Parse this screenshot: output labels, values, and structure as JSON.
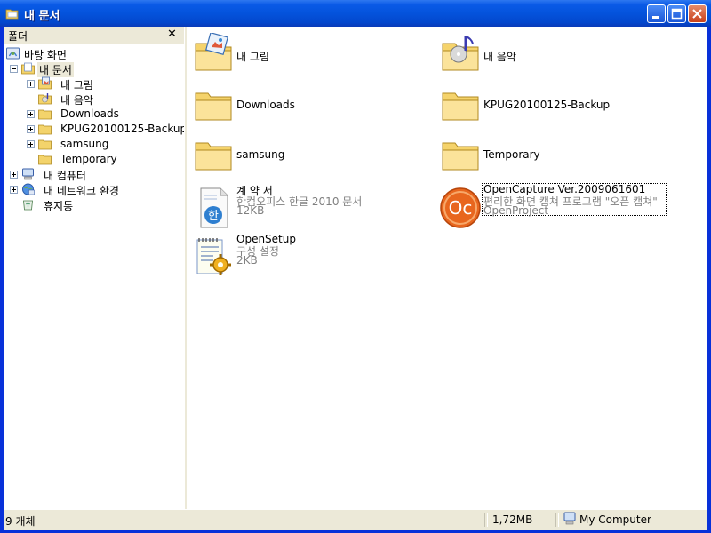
{
  "window": {
    "title": "내 문서"
  },
  "folder_pane": {
    "header": "폴더",
    "tree": [
      {
        "label": "바탕 화면",
        "icon": "desktop-icon",
        "level": 0,
        "expander": "none"
      },
      {
        "label": "내 문서",
        "icon": "my-documents-icon",
        "level": 1,
        "expander": "minus",
        "selected": true
      },
      {
        "label": "내 그림",
        "icon": "my-pictures-icon",
        "level": 2,
        "expander": "plus"
      },
      {
        "label": "내 음악",
        "icon": "my-music-icon",
        "level": 2,
        "expander": "none"
      },
      {
        "label": "Downloads",
        "icon": "folder-icon",
        "level": 2,
        "expander": "plus"
      },
      {
        "label": "KPUG20100125-Backup",
        "icon": "folder-icon",
        "level": 2,
        "expander": "plus"
      },
      {
        "label": "samsung",
        "icon": "folder-icon",
        "level": 2,
        "expander": "plus"
      },
      {
        "label": "Temporary",
        "icon": "folder-icon",
        "level": 2,
        "expander": "none"
      },
      {
        "label": "내 컴퓨터",
        "icon": "my-computer-icon",
        "level": 1,
        "expander": "plus"
      },
      {
        "label": "내 네트워크 환경",
        "icon": "network-icon",
        "level": 1,
        "expander": "plus"
      },
      {
        "label": "휴지통",
        "icon": "recycle-bin-icon",
        "level": 1,
        "expander": "none"
      }
    ]
  },
  "items": [
    {
      "name": "내 그림",
      "icon": "my-pictures-folder-icon"
    },
    {
      "name": "내 음악",
      "icon": "my-music-folder-icon"
    },
    {
      "name": "Downloads",
      "icon": "folder-icon"
    },
    {
      "name": "KPUG20100125-Backup",
      "icon": "folder-icon"
    },
    {
      "name": "samsung",
      "icon": "folder-icon"
    },
    {
      "name": "Temporary",
      "icon": "folder-icon"
    },
    {
      "name": "계 약 서",
      "type": "한컴오피스 한글 2010 문서",
      "size": "12KB",
      "icon": "hwp-document-icon"
    },
    {
      "name": "OpenCapture Ver.2009061601",
      "type": "편리한 화면 캡쳐 프로그램 \"오픈 캡쳐\"",
      "size": "OpenProject",
      "icon": "opencapture-app-icon",
      "selected": true
    },
    {
      "name": "OpenSetup",
      "type": "구성 설정",
      "size": "2KB",
      "icon": "config-settings-icon"
    }
  ],
  "status": {
    "count": "9 개체",
    "size": "1,72MB",
    "zone": "My Computer"
  },
  "colors": {
    "title_bar": "#0453dc",
    "selection": "#ece9d8",
    "folder": "#f5d36b"
  }
}
